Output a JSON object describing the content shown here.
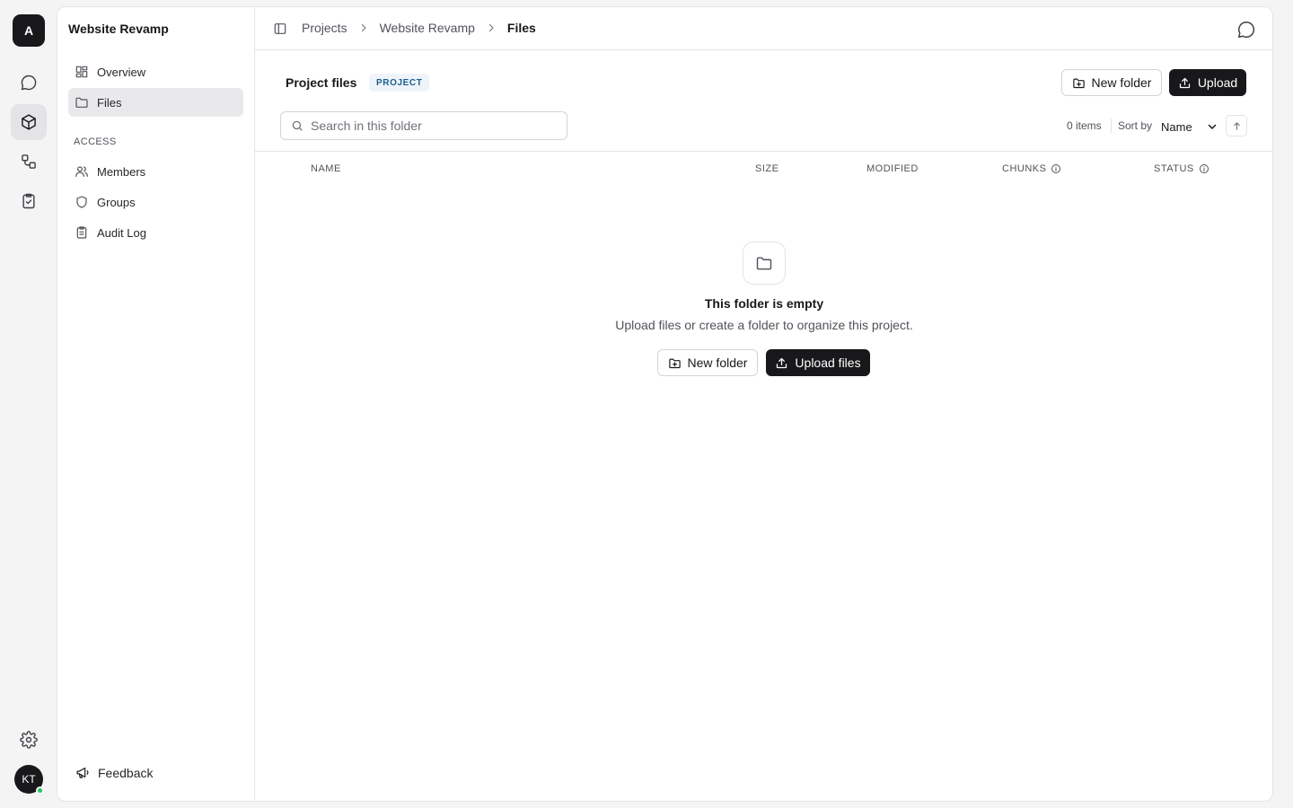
{
  "rail": {
    "workspace_initial": "A",
    "user_initials": "KT"
  },
  "sidebar": {
    "project_title": "Website Revamp",
    "nav": [
      {
        "label": "Overview",
        "icon": "grid-icon"
      },
      {
        "label": "Files",
        "icon": "folder-icon",
        "active": true
      }
    ],
    "access_label": "ACCESS",
    "access": [
      {
        "label": "Members",
        "icon": "users-icon"
      },
      {
        "label": "Groups",
        "icon": "shield-icon"
      },
      {
        "label": "Audit Log",
        "icon": "clipboard-icon"
      }
    ],
    "feedback_label": "Feedback"
  },
  "breadcrumb": [
    "Projects",
    "Website Revamp",
    "Files"
  ],
  "header": {
    "title": "Project files",
    "badge": "PROJECT",
    "new_folder_label": "New folder",
    "upload_label": "Upload"
  },
  "toolbar": {
    "search_placeholder": "Search in this folder",
    "items_count": "0 items",
    "sort_label": "Sort by",
    "sort_value": "Name"
  },
  "table": {
    "columns": [
      "NAME",
      "SIZE",
      "MODIFIED",
      "CHUNKS",
      "STATUS"
    ]
  },
  "empty": {
    "title": "This folder is empty",
    "description": "Upload files or create a folder to organize this project.",
    "new_folder_label": "New folder",
    "upload_label": "Upload files"
  },
  "colors": {
    "primary": "#18181b",
    "badge_bg": "#eef4fa",
    "badge_text": "#1d5d8c",
    "presence": "#22c55e"
  }
}
